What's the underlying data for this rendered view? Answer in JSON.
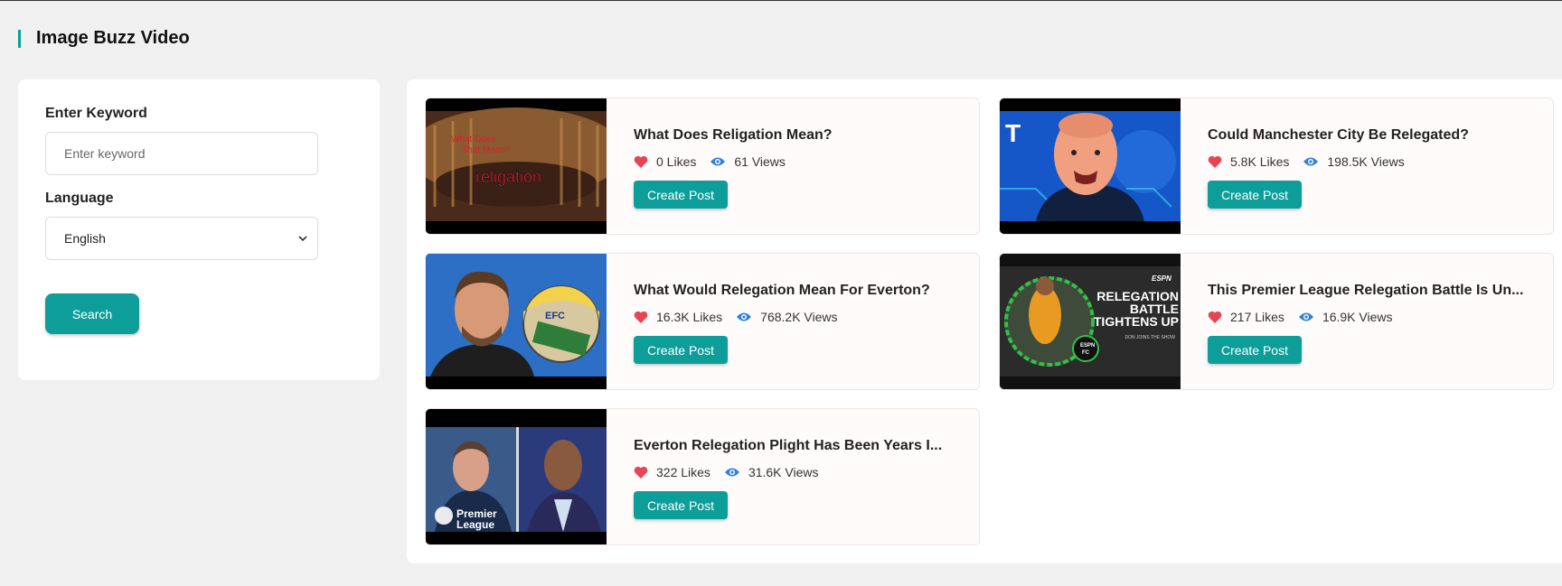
{
  "header": {
    "title": "Image Buzz Video"
  },
  "filters": {
    "keyword_label": "Enter Keyword",
    "keyword_placeholder": "Enter keyword",
    "language_label": "Language",
    "language_value": "English",
    "search_label": "Search"
  },
  "colors": {
    "accent": "#0e9e9a",
    "heart": "#e74555",
    "eye": "#2f80d8"
  },
  "videos": [
    {
      "title": "What Does Religation Mean?",
      "likes": "0 Likes",
      "views": "61 Views",
      "action": "Create Post",
      "thumb_text": [
        "What Does",
        "That Mean?",
        "religation"
      ]
    },
    {
      "title": "Could Manchester City Be Relegated?",
      "likes": "5.8K Likes",
      "views": "198.5K Views",
      "action": "Create Post",
      "thumb_text": [
        "T"
      ]
    },
    {
      "title": "What Would Relegation Mean For Everton?",
      "likes": "16.3K Likes",
      "views": "768.2K Views",
      "action": "Create Post",
      "thumb_text": [
        "EFC"
      ]
    },
    {
      "title": "This Premier League Relegation Battle Is Un...",
      "likes": "217 Likes",
      "views": "16.9K Views",
      "action": "Create Post",
      "thumb_text": [
        "ESPN",
        "RELEGATION",
        "BATTLE",
        "TIGHTENS UP",
        "DON JOINS THE SHOW",
        "ESPN",
        "FC"
      ]
    },
    {
      "title": "Everton Relegation Plight Has Been Years I...",
      "likes": "322 Likes",
      "views": "31.6K Views",
      "action": "Create Post",
      "thumb_text": [
        "Premier",
        "League"
      ]
    }
  ]
}
